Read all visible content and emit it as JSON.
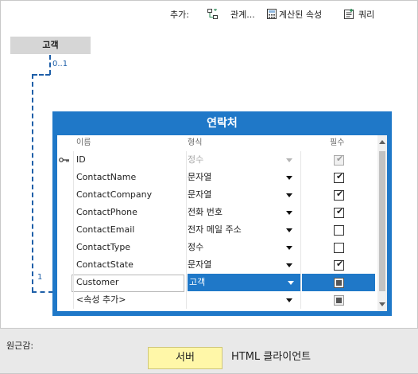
{
  "toolbar": {
    "add_label": "추가:",
    "relation_label": "관계...",
    "computed_label": "계산된 속성",
    "query_label": "쿼리"
  },
  "parent_entity": {
    "name": "고객",
    "multiplicity_top": "0..1",
    "multiplicity_bottom": "1"
  },
  "entity": {
    "title": "연락처",
    "columns": {
      "name": "이름",
      "type": "형식",
      "required": "필수"
    },
    "rows": [
      {
        "name": "ID",
        "type": "정수",
        "required": true,
        "key": true,
        "disabled": true
      },
      {
        "name": "ContactName",
        "type": "문자열",
        "required": true
      },
      {
        "name": "ContactCompany",
        "type": "문자열",
        "required": true
      },
      {
        "name": "ContactPhone",
        "type": "전화 번호",
        "required": true
      },
      {
        "name": "ContactEmail",
        "type": "전자 메일 주소",
        "required": false
      },
      {
        "name": "ContactType",
        "type": "정수",
        "required": false
      },
      {
        "name": "ContactState",
        "type": "문자열",
        "required": true
      },
      {
        "name": "Customer",
        "type": "고객",
        "required": "indeterminate",
        "selected": true
      },
      {
        "name": "<속성 추가>",
        "type": "",
        "required": "indeterminate",
        "add_row": true
      }
    ]
  },
  "perspective": {
    "label": "원근감:",
    "server": "서버",
    "client": "HTML 클라이언트"
  },
  "colors": {
    "accent": "#1f78c8",
    "server_bg": "#fff7a8",
    "relation": "#1e5fa8"
  }
}
